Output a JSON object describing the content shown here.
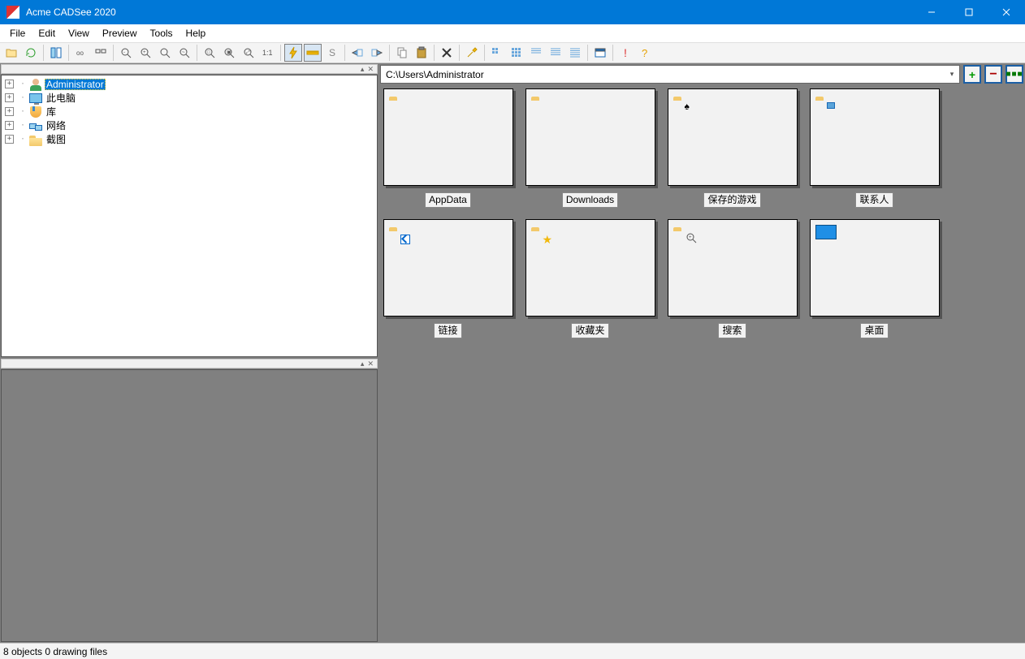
{
  "title": "Acme CADSee 2020",
  "menu": [
    "File",
    "Edit",
    "View",
    "Preview",
    "Tools",
    "Help"
  ],
  "toolbar": [
    {
      "name": "open-icon",
      "sep": false
    },
    {
      "name": "refresh-icon",
      "sep": true
    },
    {
      "name": "panes-icon",
      "sep": true
    },
    {
      "name": "thumbs-small-icon"
    },
    {
      "name": "thumbs-large-icon",
      "sep": true
    },
    {
      "name": "zoom-out-icon"
    },
    {
      "name": "zoom-in-icon"
    },
    {
      "name": "zoom-reset-icon"
    },
    {
      "name": "zoom-hand-icon",
      "sep": true
    },
    {
      "name": "zoom-window-icon"
    },
    {
      "name": "zoom-fit-icon"
    },
    {
      "name": "zoom-extents-icon"
    },
    {
      "name": "zoom-11-icon",
      "sep": true
    },
    {
      "name": "bolt-icon",
      "pressed": true
    },
    {
      "name": "ruler-icon",
      "pressed": true
    },
    {
      "name": "s-icon",
      "sep": true
    },
    {
      "name": "layer-left-icon"
    },
    {
      "name": "layer-right-icon",
      "sep": true
    },
    {
      "name": "copy-icon"
    },
    {
      "name": "paste-icon",
      "sep": true
    },
    {
      "name": "delete-icon",
      "sep": true
    },
    {
      "name": "tools-icon",
      "sep": true
    },
    {
      "name": "grid1-icon"
    },
    {
      "name": "grid2-icon"
    },
    {
      "name": "list1-icon"
    },
    {
      "name": "list2-icon"
    },
    {
      "name": "details-icon",
      "sep": true
    },
    {
      "name": "window-icon",
      "sep": true
    },
    {
      "name": "warn-icon"
    },
    {
      "name": "help-icon"
    }
  ],
  "tree": [
    {
      "label": "Administrator",
      "icon": "user",
      "selected": true,
      "expand": "+"
    },
    {
      "label": "此电脑",
      "icon": "monitor",
      "expand": "+"
    },
    {
      "label": "库",
      "icon": "lib",
      "expand": "+"
    },
    {
      "label": "网络",
      "icon": "net",
      "expand": "+"
    },
    {
      "label": "截图",
      "icon": "folder",
      "expand": "+"
    }
  ],
  "path": "C:\\Users\\Administrator",
  "nav": {
    "plus": "+",
    "minus": "−",
    "dots": "■■■"
  },
  "items": [
    {
      "label": "AppData",
      "icon": "folder"
    },
    {
      "label": "Downloads",
      "icon": "folder"
    },
    {
      "label": "保存的游戏",
      "icon": "folder-games"
    },
    {
      "label": "联系人",
      "icon": "folder-contacts"
    },
    {
      "label": "链接",
      "icon": "folder-shortcut"
    },
    {
      "label": "收藏夹",
      "icon": "folder-star"
    },
    {
      "label": "搜索",
      "icon": "folder-search"
    },
    {
      "label": "桌面",
      "icon": "desktop"
    }
  ],
  "status": "8 objects 0 drawing files"
}
